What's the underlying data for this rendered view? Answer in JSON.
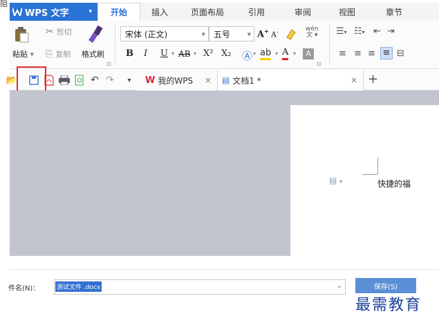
{
  "corner_glyph": "阻",
  "app": {
    "brand": "WPS 文字",
    "brand_chevron": "▾"
  },
  "tabs": [
    "开始",
    "插入",
    "页面布局",
    "引用",
    "审阅",
    "视图",
    "章节"
  ],
  "clipboard": {
    "paste": "粘贴",
    "cut": "剪切",
    "copy": "复制",
    "format_painter": "格式刷"
  },
  "font": {
    "name": "宋体 (正文)",
    "size": "五号"
  },
  "format_buttons": {
    "bold": "B",
    "italic": "I",
    "underline": "U",
    "strike": "AB",
    "superscript": "X²",
    "subscript": "X₂",
    "font_color": "A"
  },
  "doc_tabs": {
    "mywps": "我的WPS",
    "doc1": "文档1 *"
  },
  "page_text": "快捷的福",
  "save_dialog": {
    "filename_label": "件名(N)：",
    "filename_value": "测试文件 .docx",
    "save_button": "保存(S)"
  },
  "watermark": "最需教育",
  "colors": {
    "brand_blue": "#2b72d6",
    "highlight_red": "#e22a2a",
    "doc_bg": "#c2c4cf"
  }
}
